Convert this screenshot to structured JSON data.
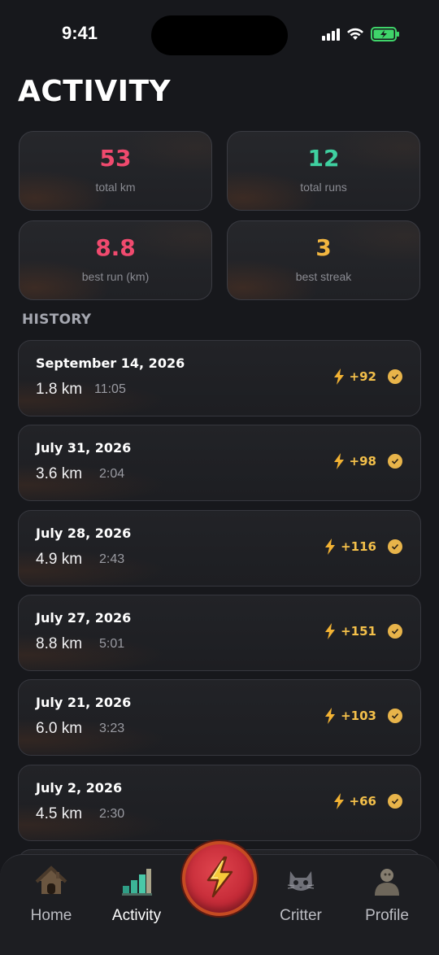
{
  "status_bar": {
    "time": "9:41"
  },
  "header": {
    "title": "ACTIVITY"
  },
  "stats": [
    {
      "value": "53",
      "label": "total km",
      "color": "#f04a6e"
    },
    {
      "value": "12",
      "label": "total runs",
      "color": "#3fd0a0"
    },
    {
      "value": "8.8",
      "label": "best run (km)",
      "color": "#f04a6e"
    },
    {
      "value": "3",
      "label": "best streak",
      "color": "#f2b640"
    }
  ],
  "history": {
    "title": "HISTORY",
    "runs": [
      {
        "date": "September 14, 2026",
        "distance": "1.8 km",
        "duration": "11:05",
        "points": "+92"
      },
      {
        "date": "July 31, 2026",
        "distance": "3.6 km",
        "duration": "2:04",
        "points": "+98"
      },
      {
        "date": "July 28, 2026",
        "distance": "4.9 km",
        "duration": "2:43",
        "points": "+116"
      },
      {
        "date": "July 27, 2026",
        "distance": "8.8 km",
        "duration": "5:01",
        "points": "+151"
      },
      {
        "date": "July 21, 2026",
        "distance": "6.0 km",
        "duration": "3:23",
        "points": "+103"
      },
      {
        "date": "July 2, 2026",
        "distance": "4.5 km",
        "duration": "2:30",
        "points": "+66"
      }
    ]
  },
  "tabs": [
    {
      "label": "Home",
      "icon": "house-icon",
      "active": false
    },
    {
      "label": "Activity",
      "icon": "bar-chart-icon",
      "active": true
    },
    {
      "label": "Critter",
      "icon": "cat-icon",
      "active": false
    },
    {
      "label": "Profile",
      "icon": "person-icon",
      "active": false
    }
  ],
  "run_button": {
    "icon": "lightning-bolt-icon"
  },
  "colors": {
    "accent_yellow": "#f4c04a",
    "background": "#17181c"
  }
}
